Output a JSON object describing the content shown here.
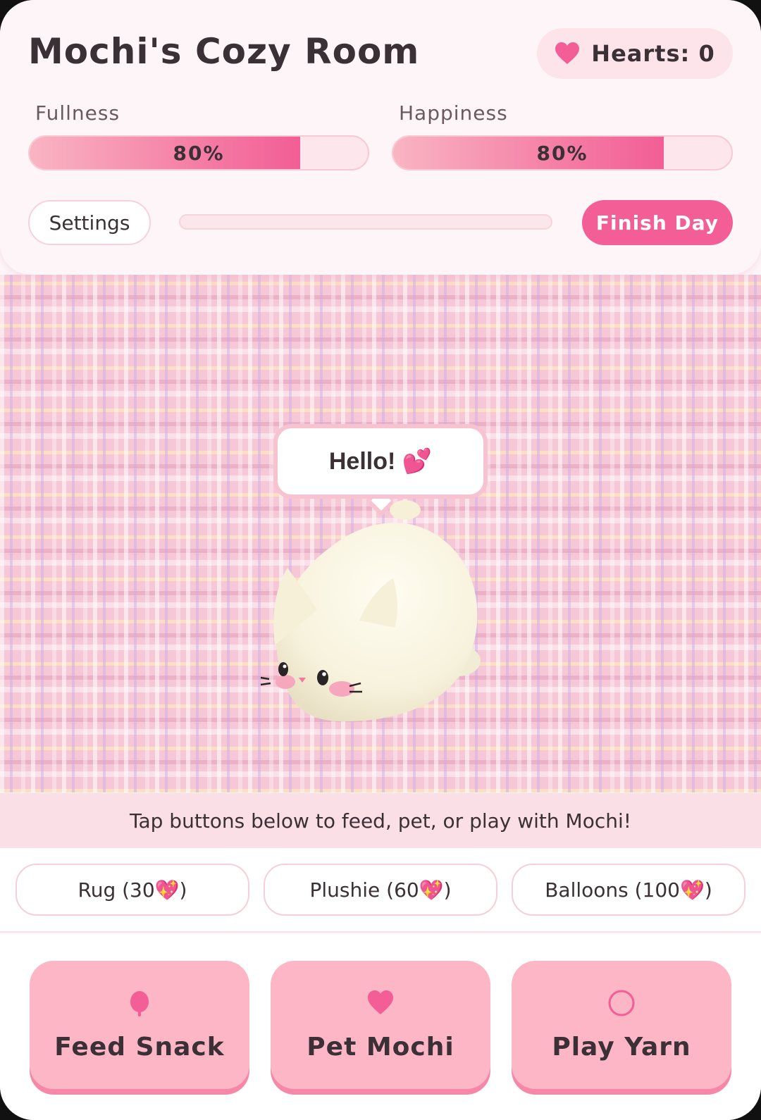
{
  "header": {
    "title": "Mochi's Cozy Room",
    "hearts_label": "Hearts: 0",
    "settings_label": "Settings",
    "finish_label": "Finish Day",
    "day_progress": 0
  },
  "stats": [
    {
      "label": "Fullness",
      "percent_text": "80%",
      "value": 0.8
    },
    {
      "label": "Happiness",
      "percent_text": "80%",
      "value": 0.8
    }
  ],
  "room": {
    "speech": "Hello! 💕"
  },
  "hint": "Tap buttons below to feed, pet, or play with Mochi!",
  "shop": [
    {
      "label": "Rug (30💖)"
    },
    {
      "label": "Plushie (60💖)"
    },
    {
      "label": "Balloons (100💖)"
    }
  ],
  "actions": [
    {
      "label": "Feed Snack",
      "icon": "snack-icon"
    },
    {
      "label": "Pet Mochi",
      "icon": "heart-icon"
    },
    {
      "label": "Play Yarn",
      "icon": "yarn-icon"
    }
  ],
  "colors": {
    "accent": "#f25e95",
    "bar_bg": "#fde7ec",
    "button_pink": "#fcb6c5",
    "text": "#3b3035"
  }
}
